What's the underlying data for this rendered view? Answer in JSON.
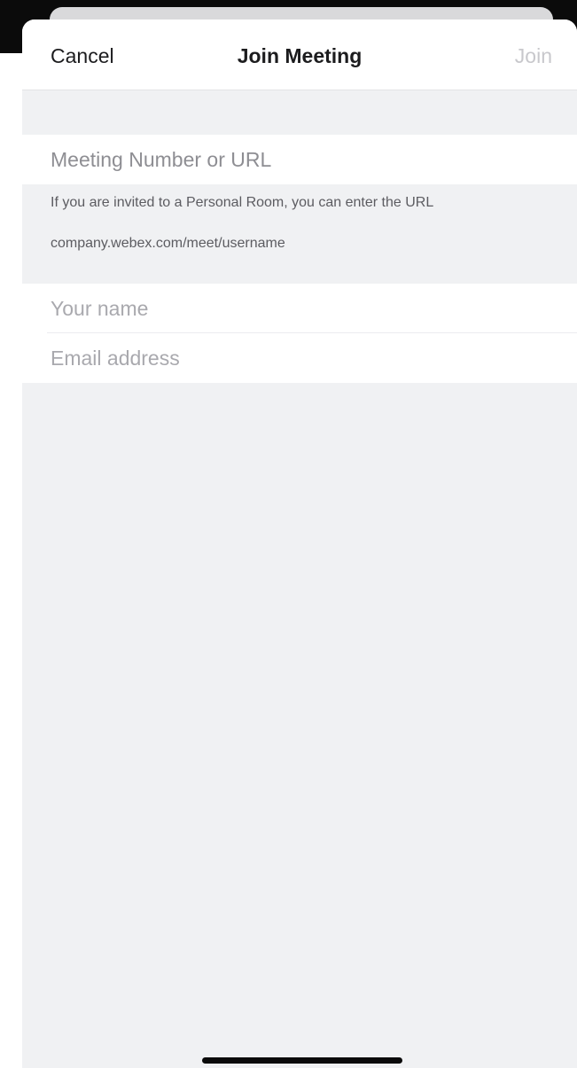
{
  "navbar": {
    "cancel_label": "Cancel",
    "title": "Join Meeting",
    "join_label": "Join"
  },
  "form": {
    "meeting_placeholder": "Meeting Number or URL",
    "hint_line1": "If you are invited to a Personal Room, you can enter the URL",
    "hint_line2": "company.webex.com/meet/username",
    "name_placeholder": "Your name",
    "email_placeholder": "Email address"
  },
  "colors": {
    "sheet_background": "#f0f1f3",
    "join_disabled": "#c8c8cc",
    "backdrop": "#0b0b0b"
  }
}
